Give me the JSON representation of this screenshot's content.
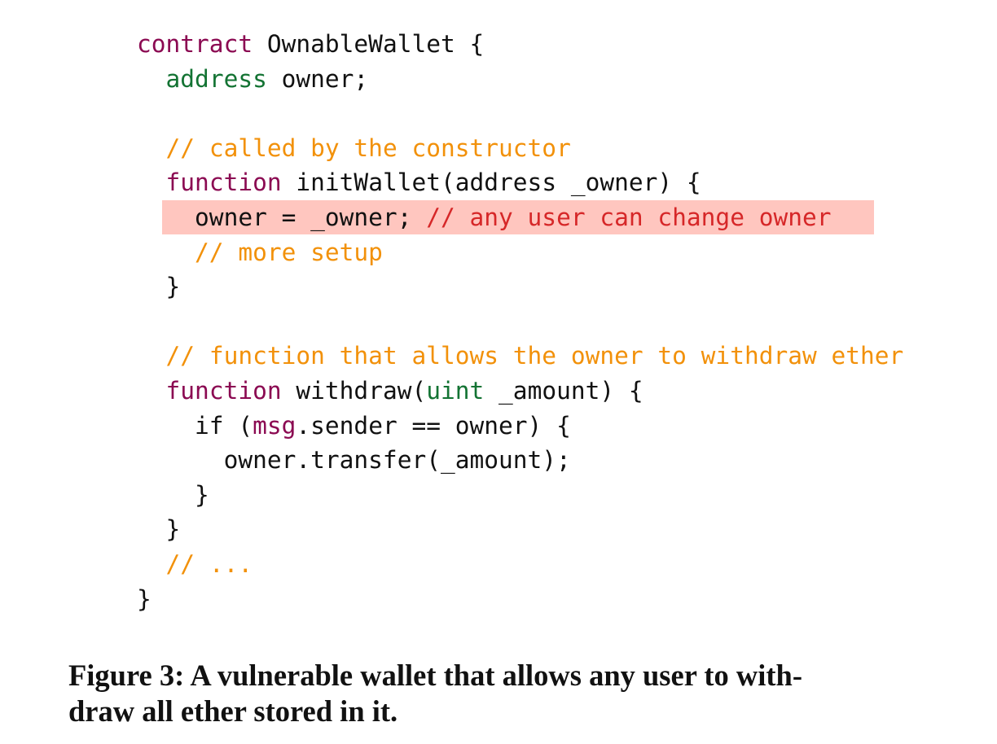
{
  "colors": {
    "keyword": "#8b0a52",
    "type": "#137333",
    "plain": "#111111",
    "comment": "#f2910a",
    "danger": "#d62728",
    "highlight_bg": "#ffc6bf"
  },
  "code": {
    "lines": [
      {
        "tokens": [
          {
            "t": "contract",
            "c": "keyword"
          },
          {
            "t": " OwnableWallet {",
            "c": "plain"
          }
        ]
      },
      {
        "tokens": [
          {
            "t": "  ",
            "c": "plain"
          },
          {
            "t": "address",
            "c": "type"
          },
          {
            "t": " owner;",
            "c": "plain"
          }
        ]
      },
      {
        "tokens": [
          {
            "t": "",
            "c": "plain"
          }
        ]
      },
      {
        "tokens": [
          {
            "t": "  ",
            "c": "plain"
          },
          {
            "t": "// called by the constructor",
            "c": "comment"
          }
        ]
      },
      {
        "tokens": [
          {
            "t": "  ",
            "c": "plain"
          },
          {
            "t": "function",
            "c": "keyword"
          },
          {
            "t": " initWallet(address _owner) {",
            "c": "plain"
          }
        ]
      },
      {
        "highlight": true,
        "tokens": [
          {
            "t": "    owner = _owner; ",
            "c": "plain"
          },
          {
            "t": "// any user can change owner",
            "c": "danger"
          }
        ]
      },
      {
        "tokens": [
          {
            "t": "    ",
            "c": "plain"
          },
          {
            "t": "// more setup",
            "c": "comment"
          }
        ]
      },
      {
        "tokens": [
          {
            "t": "  }",
            "c": "plain"
          }
        ]
      },
      {
        "tokens": [
          {
            "t": "",
            "c": "plain"
          }
        ]
      },
      {
        "tokens": [
          {
            "t": "  ",
            "c": "plain"
          },
          {
            "t": "// function that allows the owner to withdraw ether",
            "c": "comment"
          }
        ]
      },
      {
        "tokens": [
          {
            "t": "  ",
            "c": "plain"
          },
          {
            "t": "function",
            "c": "keyword"
          },
          {
            "t": " withdraw(",
            "c": "plain"
          },
          {
            "t": "uint",
            "c": "type"
          },
          {
            "t": " _amount) {",
            "c": "plain"
          }
        ]
      },
      {
        "tokens": [
          {
            "t": "    if (",
            "c": "plain"
          },
          {
            "t": "msg",
            "c": "keyword"
          },
          {
            "t": ".sender == owner) {",
            "c": "plain"
          }
        ]
      },
      {
        "tokens": [
          {
            "t": "      owner.transfer(_amount);",
            "c": "plain"
          }
        ]
      },
      {
        "tokens": [
          {
            "t": "    }",
            "c": "plain"
          }
        ]
      },
      {
        "tokens": [
          {
            "t": "  }",
            "c": "plain"
          }
        ]
      },
      {
        "tokens": [
          {
            "t": "  ",
            "c": "plain"
          },
          {
            "t": "// ...",
            "c": "comment"
          }
        ]
      },
      {
        "tokens": [
          {
            "t": "}",
            "c": "plain"
          }
        ]
      }
    ]
  },
  "caption": {
    "text": "Figure 3: A vulnerable wallet that allows any user to with-draw all ether stored in it.",
    "line1": "Figure 3: A vulnerable wallet that allows any user to with-",
    "line2": "draw all ether stored in it."
  }
}
